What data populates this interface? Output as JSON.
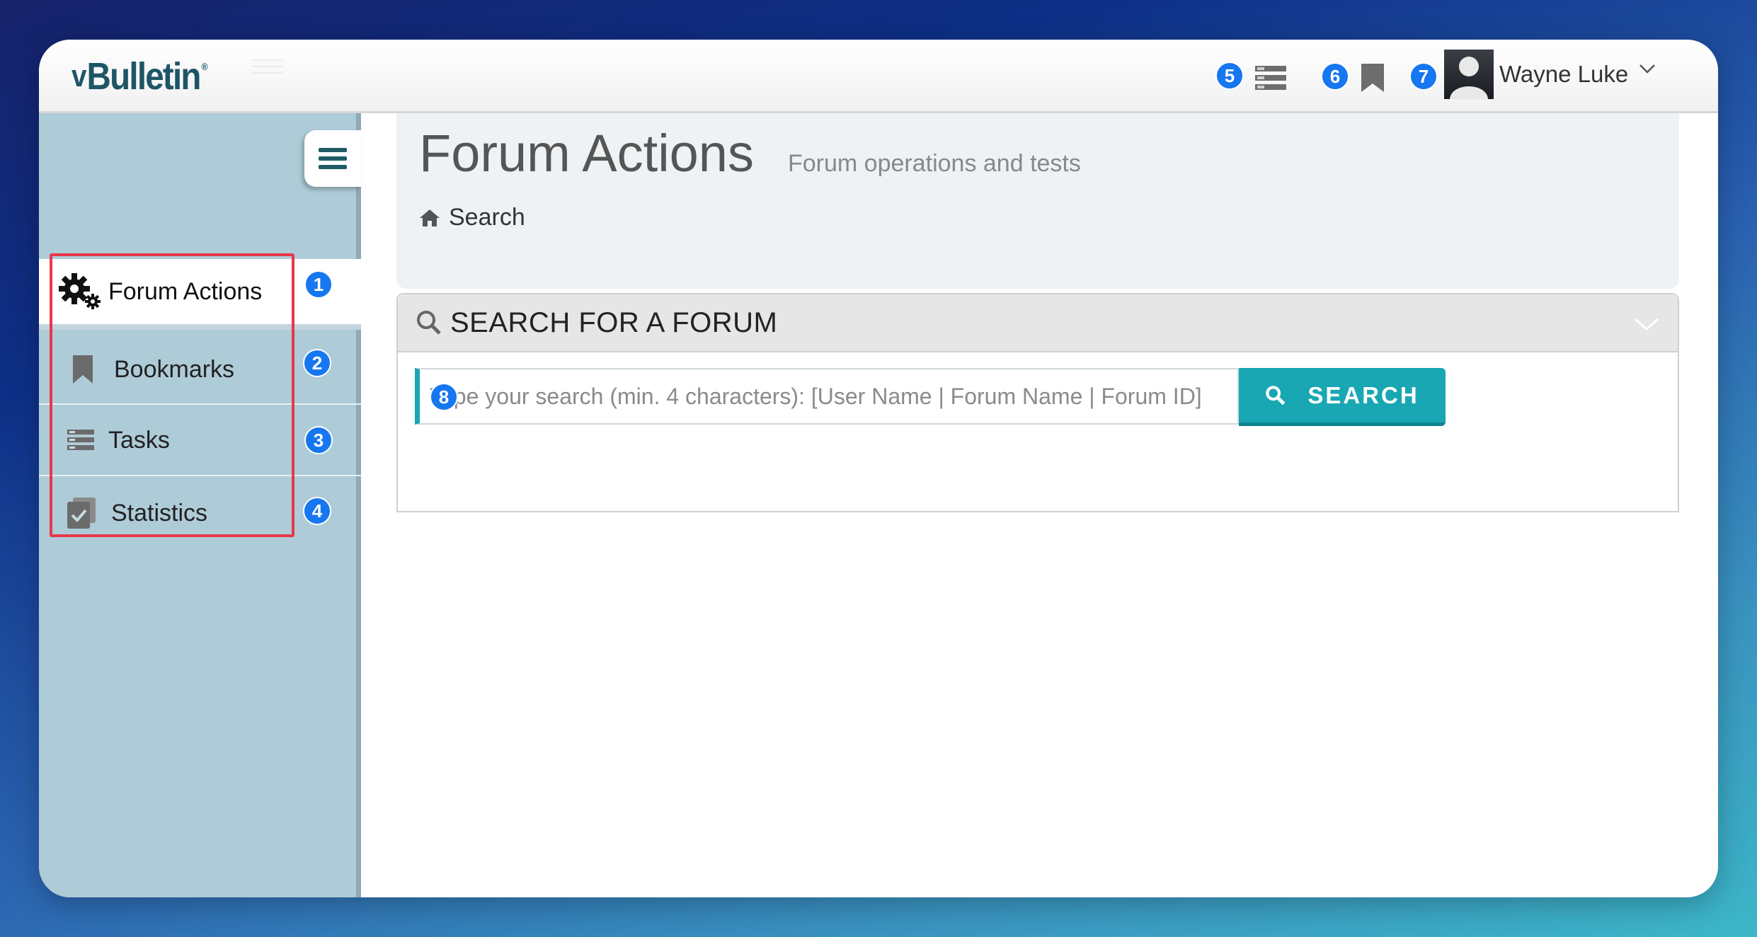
{
  "app": {
    "logo_text": "vBulletin",
    "logo_mark": "v",
    "logo_reg": "®"
  },
  "topbar": {
    "badges": [
      "5",
      "6",
      "7"
    ],
    "icons": [
      "tasks-icon",
      "bookmark-icon"
    ],
    "user_name": "Wayne Luke"
  },
  "sidebar": {
    "items": [
      {
        "label": "Forum Actions",
        "icon": "gears-icon",
        "badge": "1",
        "active": true
      },
      {
        "label": "Bookmarks",
        "icon": "bookmark-icon",
        "badge": "2"
      },
      {
        "label": "Tasks",
        "icon": "tasks-icon",
        "badge": "3"
      },
      {
        "label": "Statistics",
        "icon": "statistics-icon",
        "badge": "4"
      }
    ]
  },
  "main": {
    "title": "Forum Actions",
    "subtitle": "Forum operations and tests",
    "breadcrumb": "Search",
    "panel_title": "SEARCH FOR A FORUM",
    "search_placeholder": "Type your search (min. 4 characters): [User Name | Forum Name | Forum ID]",
    "search_button": "SEARCH",
    "input_badge": "8"
  },
  "colors": {
    "accent": "#18a7b3",
    "sidebar_bg": "#aecbd8",
    "badge": "#1677f0",
    "highlight": "#e8374a"
  }
}
